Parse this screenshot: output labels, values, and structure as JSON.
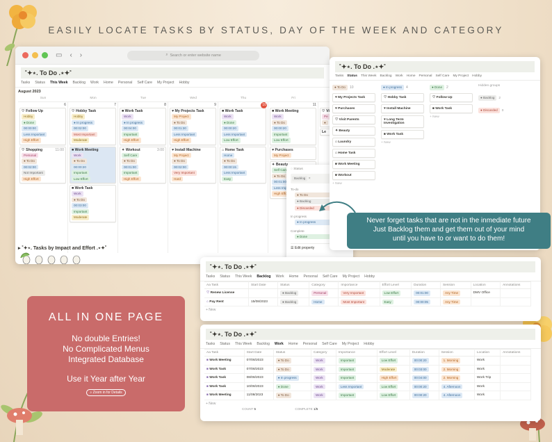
{
  "headline": "EASILY LOCATE TASKS BY STATUS, DAY OF THE WEEK AND CATEGORY",
  "colors": {
    "background": "#f1e3cf",
    "promo_pink": "#c96b6a",
    "callout_teal": "#3f7e84",
    "today_red": "#e2533f"
  },
  "browser": {
    "url_placeholder": "Search or enter website name",
    "url_icon": "search-icon"
  },
  "page_title": "˚✦⋆. To Do .⋆✦˚",
  "tabs_main": [
    "Tasks",
    "Status",
    "This Week",
    "Backlog",
    "Work",
    "Home",
    "Personal",
    "Self Care",
    "My Project",
    "Hobby"
  ],
  "tabs_short": [
    "Tasks",
    "Status",
    "This Week",
    "Backlog",
    "Work",
    "Home",
    "Personal",
    "Self Care",
    "My Project",
    "Hobby"
  ],
  "calendar": {
    "month": "August 2023",
    "weekdays": [
      "Sun",
      "Mon",
      "Tue",
      "Wed",
      "Thu",
      "Fri",
      "Sat"
    ],
    "days": [
      "6",
      "7",
      "8",
      "9",
      "10",
      "11",
      "12"
    ],
    "week1": [
      {
        "title": "Follow Up",
        "icon": "♡",
        "cat": "Hobby",
        "cat_c": "c-yellow",
        "status": "● Done",
        "st_c": "c-green",
        "dur": "00:00:00",
        "imp": "Less Important",
        "imp_c": "c-blue",
        "eff": "High Effort",
        "eff_c": "c-orange"
      },
      {
        "title": "Hobby Task",
        "icon": "♡",
        "cat": "Hobby",
        "cat_c": "c-yellow",
        "status": "● In progress",
        "st_c": "c-blue",
        "dur": "00:02:00",
        "imp": "Most Important",
        "imp_c": "c-red",
        "eff": "Moderate",
        "eff_c": "c-yellow"
      },
      {
        "title": "Work Task",
        "icon": "■",
        "cat": "Work",
        "cat_c": "c-purple",
        "status": "● In progress",
        "st_c": "c-blue",
        "dur": "00:04:00",
        "imp": "Important",
        "imp_c": "c-green",
        "eff": "High Effort",
        "eff_c": "c-orange"
      },
      {
        "title": "My Projects Task",
        "icon": "♥",
        "cat": "My Project",
        "cat_c": "c-orange",
        "status": "● To Do",
        "st_c": "c-brown",
        "dur": "00:01:30",
        "imp": "Less Important",
        "imp_c": "c-blue",
        "eff": "High Effort",
        "eff_c": "c-orange"
      },
      {
        "title": "Work Task",
        "icon": "■",
        "cat": "Work",
        "cat_c": "c-purple",
        "status": "● Done",
        "st_c": "c-green",
        "dur": "00:00:20",
        "imp": "Less Important",
        "imp_c": "c-blue",
        "eff": "Low Effort",
        "eff_c": "c-green"
      },
      {
        "title": "Work Meeting",
        "icon": "■",
        "cat": "Work",
        "cat_c": "c-purple",
        "status": "● To Do",
        "st_c": "c-brown",
        "dur": "00:00:20",
        "imp": "Important",
        "imp_c": "c-green",
        "eff": "Low Effort",
        "eff_c": "c-green"
      },
      {
        "title": "Vi",
        "icon": "♡",
        "cat": "Pe",
        "cat_c": "c-pink",
        "status": "●",
        "st_c": "c-brown",
        "dur": "",
        "imp": "",
        "imp_c": "c-blue",
        "eff": "",
        "eff_c": "c-green"
      }
    ],
    "week2": [
      {
        "title": "Shopping",
        "icon": "♡",
        "time": "11:00",
        "cat": "Personal",
        "cat_c": "c-pink",
        "status": "● To Do",
        "st_c": "c-brown",
        "dur": "00:02:00",
        "imp": "Not Important",
        "imp_c": "c-gray",
        "eff": "High Effort",
        "eff_c": "c-orange"
      },
      {
        "title": "Work Meeting",
        "icon": "■",
        "time": "",
        "cat": "Work",
        "cat_c": "c-purple",
        "status": "● To Do",
        "st_c": "c-brown",
        "dur": "00:00:20",
        "imp": "Important",
        "imp_c": "c-green",
        "eff": "Low Effort",
        "eff_c": "c-green",
        "sel": true
      },
      {
        "title": "Workout",
        "icon": "✦",
        "time": "3:00",
        "cat": "Self Care",
        "cat_c": "c-green",
        "status": "● To Do",
        "st_c": "c-brown",
        "dur": "00:01:00",
        "imp": "Important",
        "imp_c": "c-green",
        "eff": "High Effort",
        "eff_c": "c-orange"
      },
      {
        "title": "Install Machine",
        "icon": "♥",
        "time": "",
        "cat": "My Project",
        "cat_c": "c-orange",
        "status": "● To Do",
        "st_c": "c-brown",
        "dur": "00:02:00",
        "imp": "Very Important",
        "imp_c": "c-red",
        "eff": "Hard",
        "eff_c": "c-orange"
      },
      {
        "title": "Home Task",
        "icon": "⌂",
        "time": "",
        "cat": "Home",
        "cat_c": "c-blue",
        "status": "● To Do",
        "st_c": "c-brown",
        "dur": "00:00:15",
        "imp": "Less Important",
        "imp_c": "c-blue",
        "eff": "Easy",
        "eff_c": "c-green"
      },
      {
        "title": "Purchases",
        "icon": "♥",
        "time": "",
        "cat": "My Project",
        "cat_c": "c-orange",
        "status": "",
        "st_c": "c-brown",
        "dur": "",
        "imp": "",
        "imp_c": "c-blue",
        "eff": "",
        "eff_c": "c-green"
      },
      {
        "title": "Le",
        "icon": "",
        "time": "",
        "cat": "",
        "cat_c": "c-gray",
        "status": "",
        "st_c": "c-brown",
        "dur": "",
        "imp": "",
        "imp_c": "c-blue",
        "eff": "",
        "eff_c": "c-green"
      }
    ],
    "extra_work": {
      "title": "Work Task",
      "cat": "Work",
      "status": "● To Do",
      "dur": "00:03:00",
      "imp": "Important",
      "eff": "Moderate"
    },
    "extra_beauty": {
      "title": "Beauty",
      "cat": "Self Care",
      "status": "● To Do",
      "dur": "00:01:00",
      "imp": "Less Important",
      "eff": "High Effort"
    },
    "section": "▸  ˚✦⋆. Tasks by Impact and Effort .⋆✦˚"
  },
  "status_popup": {
    "prop": "Status",
    "current": "Backlog",
    "sections": [
      {
        "label": "To-do",
        "options": [
          {
            "t": "● To Do",
            "c": "c-brown"
          },
          {
            "t": "● Backlog",
            "c": "c-gray"
          },
          {
            "t": "● Discarded",
            "c": "c-red"
          }
        ]
      },
      {
        "label": "In progress",
        "options": [
          {
            "t": "● In progress",
            "c": "c-blue"
          }
        ]
      },
      {
        "label": "Complete",
        "options": [
          {
            "t": "● Done",
            "c": "c-green"
          }
        ]
      }
    ],
    "edit": "Edit property"
  },
  "board": {
    "columns": [
      {
        "label": "● To Do",
        "c": "c-brown",
        "count": "10",
        "cards": [
          "♥ My Projects Task",
          "♥ Purchases",
          "♡ Visit Parents",
          "✦ Beauty",
          "⌂ Laundry",
          "⌂ Home Task",
          "■ Work Meeting",
          "■ Workout"
        ]
      },
      {
        "label": "● In progress",
        "c": "c-blue",
        "count": "4",
        "cards": [
          "♡ Hobby Task",
          "♥ Install Machine",
          "♥ Long Term Investigation",
          "■ Work Task"
        ]
      },
      {
        "label": "● Done",
        "c": "c-green",
        "count": "2",
        "cards": [
          "♡ Follow Up",
          "■ Work Task"
        ]
      }
    ],
    "new_label": "+ New",
    "hidden": {
      "label": "Hidden groups",
      "items": [
        {
          "t": "● Backlog",
          "c": "c-gray",
          "n": "2"
        },
        {
          "t": "● Discarded",
          "c": "c-red",
          "n": "0"
        }
      ]
    }
  },
  "callout": [
    "Never forget tasks that are not in the inmediate future",
    "Just Backlog them and get them out of your mind",
    "until you have to or want to do them!"
  ],
  "backlog_table": {
    "headers": [
      "Aa Task",
      "Start Date",
      "Status",
      "Category",
      "Importance",
      "Effort Level",
      "Duration",
      "Session",
      "Location",
      "Annotations"
    ],
    "rows": [
      {
        "icon": "♡",
        "task": "Renew License",
        "date": "",
        "status": "● Backlog",
        "st_c": "c-gray",
        "cat": "Personal",
        "cat_c": "c-pink",
        "imp": "Very Important",
        "imp_c": "c-red",
        "eff": "Low Effort",
        "eff_c": "c-green",
        "dur": "00:01:00",
        "ses": "Any Time",
        "loc": "DMV Office"
      },
      {
        "icon": "⌂",
        "task": "Pay Rent",
        "date": "15/08/2023",
        "status": "● Backlog",
        "st_c": "c-gray",
        "cat": "Home",
        "cat_c": "c-blue",
        "imp": "Most Important",
        "imp_c": "c-red",
        "eff": "Easy",
        "eff_c": "c-green",
        "dur": "00:00:05",
        "ses": "Any Time",
        "loc": ""
      }
    ],
    "new_label": "+ New"
  },
  "work_table": {
    "headers": [
      "Aa Task",
      "Start Date",
      "Status",
      "Category",
      "Importance",
      "Effort Level",
      "Duration",
      "Session",
      "Location",
      "Annotations"
    ],
    "rows": [
      {
        "task": "Work Meeting",
        "date": "07/08/2023",
        "status": "● To Do",
        "st_c": "c-brown",
        "imp": "Important",
        "imp_c": "c-green",
        "eff": "Low Effort",
        "eff_c": "c-green",
        "dur": "00:00:20",
        "ses": "1. Morning",
        "loc": "Work"
      },
      {
        "task": "Work Task",
        "date": "07/08/2023",
        "status": "● To Do",
        "st_c": "c-brown",
        "imp": "Important",
        "imp_c": "c-green",
        "eff": "Moderate",
        "eff_c": "c-yellow",
        "dur": "00:03:00",
        "ses": "2. Morning",
        "loc": "Work"
      },
      {
        "task": "Work Task",
        "date": "08/08/2023",
        "status": "● In progress",
        "st_c": "c-blue",
        "imp": "Important",
        "imp_c": "c-green",
        "eff": "High Effort",
        "eff_c": "c-orange",
        "dur": "00:04:00",
        "ses": "2. Morning",
        "loc": "Work Trip"
      },
      {
        "task": "Work Task",
        "date": "10/08/2023",
        "status": "● Done",
        "st_c": "c-green",
        "imp": "Less Important",
        "imp_c": "c-blue",
        "eff": "Low Effort",
        "eff_c": "c-green",
        "dur": "00:00:20",
        "ses": "4. Afternoon",
        "loc": "Work"
      },
      {
        "task": "Work Meeting",
        "date": "11/08/2023",
        "status": "● To Do",
        "st_c": "c-brown",
        "imp": "Important",
        "imp_c": "c-green",
        "eff": "Low Effort",
        "eff_c": "c-green",
        "dur": "00:00:20",
        "ses": "4. Afternoon",
        "loc": "Work"
      }
    ],
    "new_label": "+ New",
    "count_label": "COUNT",
    "count": "5",
    "complete_label": "COMPLETE",
    "complete": "1/5"
  },
  "promo": {
    "title": "ALL IN ONE PAGE",
    "lines": [
      "No double Entries!",
      "No Complicated Menus",
      "Integrated Database"
    ],
    "tagline": "Use it Year after Year",
    "zoom": "Zoom in for Details"
  }
}
